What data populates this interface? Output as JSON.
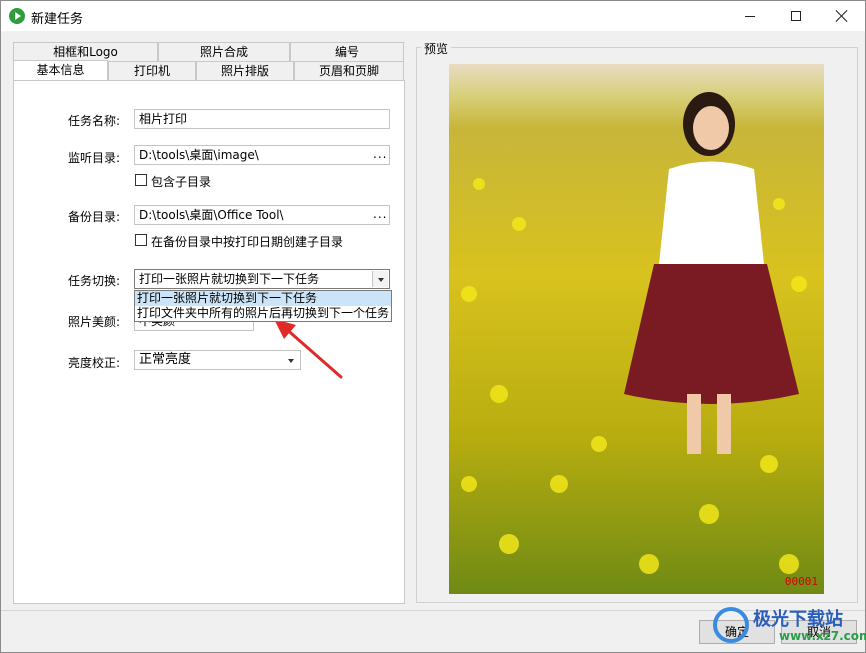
{
  "window": {
    "title": "新建任务",
    "controls": {
      "minimize": "minimize",
      "maximize": "maximize",
      "close": "close"
    }
  },
  "tabs": {
    "row1": [
      "相框和Logo",
      "照片合成",
      "编号"
    ],
    "row2": [
      "基本信息",
      "打印机",
      "照片排版",
      "页眉和页脚"
    ],
    "active": "基本信息"
  },
  "form": {
    "task_name": {
      "label": "任务名称:",
      "value": "相片打印"
    },
    "watch_dir": {
      "label": "监听目录:",
      "value": "D:\\tools\\桌面\\image\\",
      "browse": "..."
    },
    "include_subdirs": {
      "label": "包含子目录",
      "checked": false
    },
    "backup_dir": {
      "label": "备份目录:",
      "value": "D:\\tools\\桌面\\Office Tool\\",
      "browse": "..."
    },
    "backup_by_date": {
      "label": "在备份目录中按打印日期创建子目录",
      "checked": false
    },
    "task_switch": {
      "label": "任务切换:",
      "value": "打印一张照片就切换到下一下任务",
      "options": [
        "打印一张照片就切换到下一下任务",
        "打印文件夹中所有的照片后再切换到下一个任务"
      ]
    },
    "beautify": {
      "label": "照片美颜:",
      "value": "不美颜"
    },
    "brightness": {
      "label": "亮度校正:",
      "value": "正常亮度"
    }
  },
  "preview": {
    "legend": "预览",
    "serial": "00001"
  },
  "buttons": {
    "ok": "确定",
    "cancel": "取消"
  },
  "watermark": {
    "main": "极光下载站",
    "sub": "www.xz7.com"
  },
  "colors": {
    "accent_red": "#d40000",
    "selection": "#cce4f7",
    "icon_green": "#2e9d3c"
  }
}
